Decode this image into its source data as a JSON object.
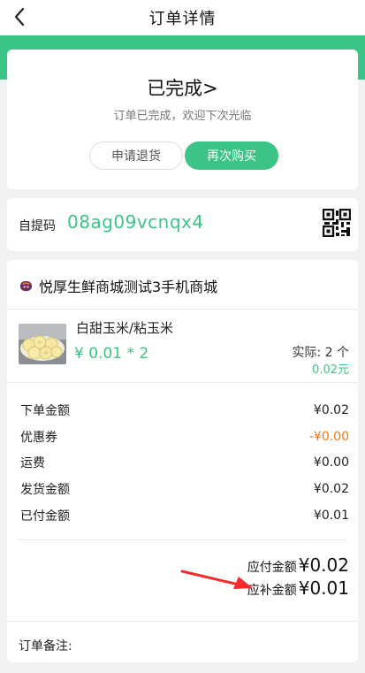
{
  "nav": {
    "title": "订单详情"
  },
  "status": {
    "title": "已完成>",
    "subtitle": "订单已完成，欢迎下次光临",
    "refund_button": "申请退货",
    "rebuy_button": "再次购买"
  },
  "pickup": {
    "label": "自提码",
    "code": "08ag09vcnqx4",
    "icon": "qr-code-icon"
  },
  "shop": {
    "name": "悦厚生鲜商城测试3手机商城",
    "icon": "shop-logo-icon"
  },
  "product": {
    "name": "白甜玉米/粘玉米",
    "price": "¥ 0.01 * 2",
    "quantity": "实际: 2 个",
    "total": "0.02元"
  },
  "fees": [
    {
      "label": "下单金额",
      "value": "¥0.02"
    },
    {
      "label": "优惠券",
      "value": "-¥0.00"
    },
    {
      "label": "运费",
      "value": "¥0.00"
    },
    {
      "label": "发货金额",
      "value": "¥0.02"
    },
    {
      "label": "已付金额",
      "value": "¥0.01"
    }
  ],
  "summary": {
    "payable_label": "应付金额",
    "payable_value": "¥0.02",
    "supplement_label": "应补金额",
    "supplement_value": "¥0.01"
  },
  "remark": {
    "label": "订单备注:"
  },
  "colors": {
    "accent": "#3cc486",
    "discount": "#ef7a1a",
    "annotation_arrow": "#f52a2a"
  }
}
